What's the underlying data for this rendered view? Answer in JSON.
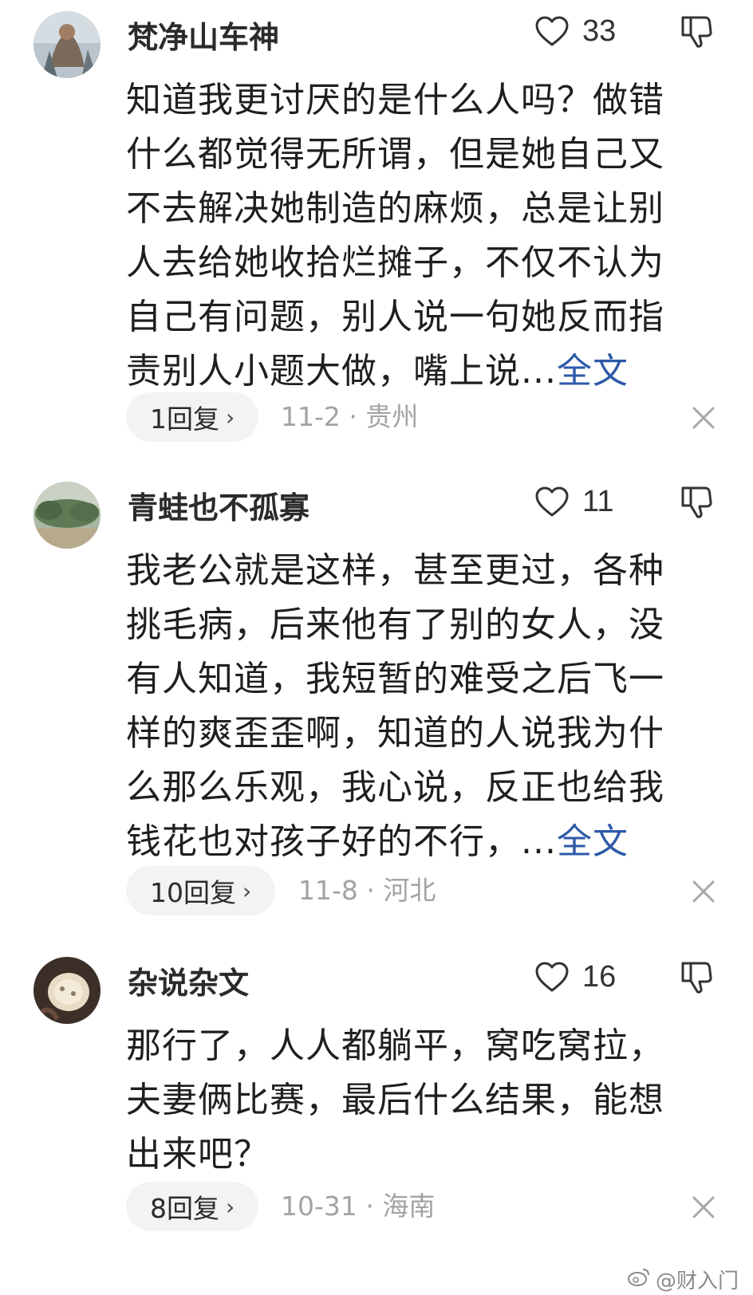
{
  "comments": [
    {
      "username": "梵净山车神",
      "likes": "33",
      "text": "知道我更讨厌的是什么人吗？做错什么都觉得无所谓，但是她自己又不去解决她制造的麻烦，总是让别人去给她收拾烂摊子，不仅不认为自己有问题，别人说一句她反而指责别人小题大做，嘴上说...",
      "full_text_label": "全文",
      "replies": "1回复",
      "meta": "11-2 · 贵州"
    },
    {
      "username": "青蛙也不孤寡",
      "likes": "11",
      "text": "我老公就是这样，甚至更过，各种挑毛病，后来他有了别的女人，没有人知道，我短暂的难受之后飞一样的爽歪歪啊，知道的人说我为什么那么乐观，我心说，反正也给我钱花也对孩子好的不行，...",
      "full_text_label": "全文",
      "replies": "10回复",
      "meta": "11-8 · 河北"
    },
    {
      "username": "杂说杂文",
      "likes": "16",
      "text": "那行了，人人都躺平，窝吃窝拉，夫妻俩比赛，最后什么结果，能想出来吧？",
      "full_text_label": "",
      "replies": "8回复",
      "meta": "10-31 · 海南"
    }
  ],
  "icons": {
    "like": "heart-outline-icon",
    "dislike": "thumbs-down-outline-icon",
    "dismiss": "close-icon",
    "reply_chevron": "›"
  },
  "watermark": "@财入门",
  "colors": {
    "link": "#2d5aa8",
    "meta": "#a3a3a3",
    "pill_bg": "#f3f3f3"
  }
}
